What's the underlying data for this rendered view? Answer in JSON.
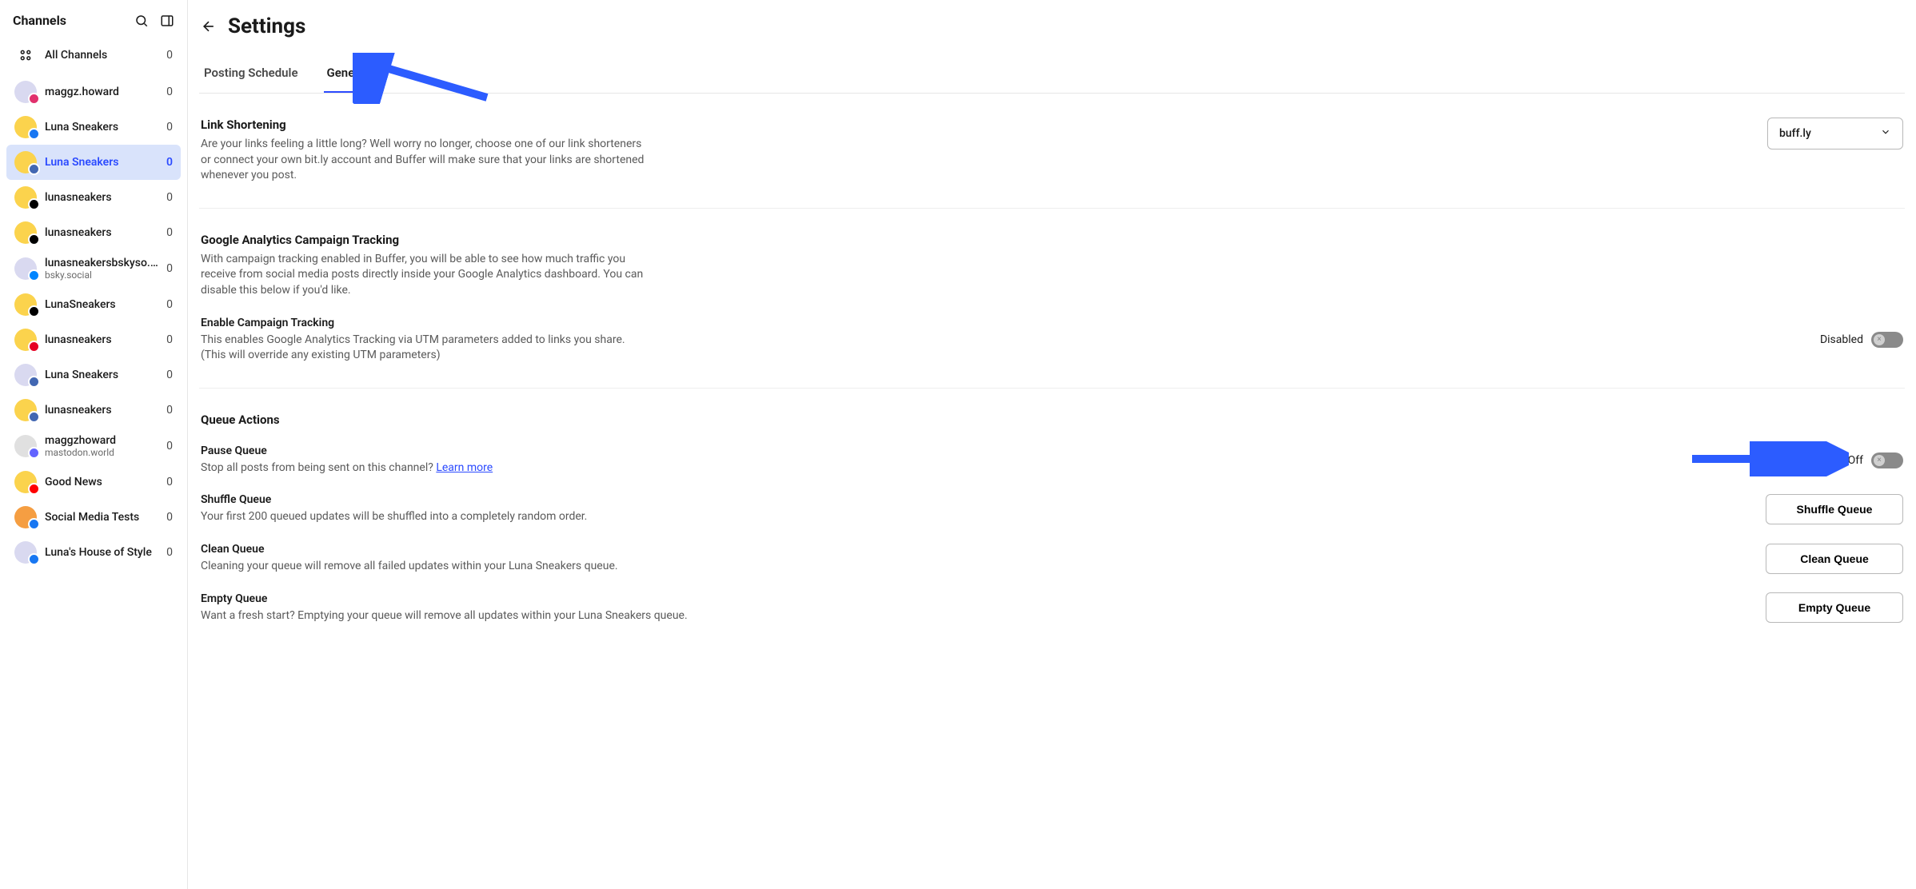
{
  "sidebar": {
    "title": "Channels",
    "all_channels": {
      "label": "All Channels",
      "count": "0"
    },
    "items": [
      {
        "name": "maggz.howard",
        "sub": "",
        "count": "0",
        "avatar_bg": "#d9d9f0",
        "badge_bg": "#e1306c"
      },
      {
        "name": "Luna Sneakers",
        "sub": "",
        "count": "0",
        "avatar_bg": "#fbd34d",
        "badge_bg": "#1877f2"
      },
      {
        "name": "Luna Sneakers",
        "sub": "",
        "count": "0",
        "avatar_bg": "#fbd34d",
        "badge_bg": "#4267b2",
        "selected": true
      },
      {
        "name": "lunasneakers",
        "sub": "",
        "count": "0",
        "avatar_bg": "#fbd34d",
        "badge_bg": "#000000"
      },
      {
        "name": "lunasneakers",
        "sub": "",
        "count": "0",
        "avatar_bg": "#fbd34d",
        "badge_bg": "#000000"
      },
      {
        "name": "lunasneakersbskyso.bsky.social",
        "sub": "bsky.social",
        "count": "0",
        "avatar_bg": "#d9d9f0",
        "badge_bg": "#0085ff"
      },
      {
        "name": "LunaSneakers",
        "sub": "",
        "count": "0",
        "avatar_bg": "#fbd34d",
        "badge_bg": "#000000"
      },
      {
        "name": "lunasneakers",
        "sub": "",
        "count": "0",
        "avatar_bg": "#fbd34d",
        "badge_bg": "#e60023"
      },
      {
        "name": "Luna Sneakers",
        "sub": "",
        "count": "0",
        "avatar_bg": "#d9d9f0",
        "badge_bg": "#4267b2"
      },
      {
        "name": "lunasneakers",
        "sub": "",
        "count": "0",
        "avatar_bg": "#fbd34d",
        "badge_bg": "#4267b2"
      },
      {
        "name": "maggzhoward",
        "sub": "mastodon.world",
        "count": "0",
        "avatar_bg": "#e0e0e0",
        "badge_bg": "#6364ff"
      },
      {
        "name": "Good News",
        "sub": "",
        "count": "0",
        "avatar_bg": "#fbd34d",
        "badge_bg": "#ff0000"
      },
      {
        "name": "Social Media Tests",
        "sub": "",
        "count": "0",
        "avatar_bg": "#f59e42",
        "badge_bg": "#1877f2"
      },
      {
        "name": "Luna's House of Style",
        "sub": "",
        "count": "0",
        "avatar_bg": "#d9d9f0",
        "badge_bg": "#1877f2"
      }
    ]
  },
  "header": {
    "title": "Settings",
    "tabs": [
      {
        "label": "Posting Schedule"
      },
      {
        "label": "General",
        "active": true
      }
    ]
  },
  "link_shortening": {
    "title": "Link Shortening",
    "desc": "Are your links feeling a little long? Well worry no longer, choose one of our link shorteners or connect your own bit.ly account and Buffer will make sure that your links are shortened whenever you post.",
    "selected": "buff.ly"
  },
  "ga_tracking": {
    "title": "Google Analytics Campaign Tracking",
    "desc": "With campaign tracking enabled in Buffer, you will be able to see how much traffic you receive from social media posts directly inside your Google Analytics dashboard. You can disable this below if you'd like.",
    "enable_title": "Enable Campaign Tracking",
    "enable_desc1": "This enables Google Analytics Tracking via UTM parameters added to links you share.",
    "enable_desc2": "(This will override any existing UTM parameters)",
    "toggle_state": "Disabled"
  },
  "queue_actions": {
    "title": "Queue Actions",
    "pause": {
      "title": "Pause Queue",
      "desc": "Stop all posts from being sent on this channel? ",
      "learn_more": "Learn more",
      "toggle_state": "Off"
    },
    "shuffle": {
      "title": "Shuffle Queue",
      "desc": "Your first 200 queued updates will be shuffled into a completely random order.",
      "button": "Shuffle Queue"
    },
    "clean": {
      "title": "Clean Queue",
      "desc": "Cleaning your queue will remove all failed updates within your Luna Sneakers queue.",
      "button": "Clean Queue"
    },
    "empty": {
      "title": "Empty Queue",
      "desc": "Want a fresh start? Emptying your queue will remove all updates within your Luna Sneakers queue.",
      "button": "Empty Queue"
    }
  }
}
